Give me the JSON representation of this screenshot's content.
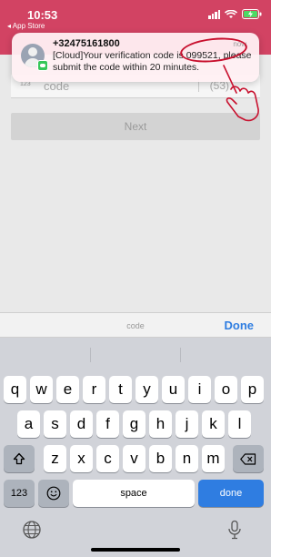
{
  "status_bar": {
    "time": "10:53",
    "back_app": "◂ App Store"
  },
  "notification": {
    "sender": "+32475161800",
    "when": "now",
    "message": "[Cloud]Your verification code is 099521, please submit the code within 20 minutes."
  },
  "form": {
    "code_icon": "123",
    "code_placeholder": "code",
    "timer": "(53)",
    "next_label": "Next"
  },
  "keyboard_toolbar": {
    "label": "code",
    "done_label": "Done"
  },
  "keyboard": {
    "row1": [
      "q",
      "w",
      "e",
      "r",
      "t",
      "y",
      "u",
      "i",
      "o",
      "p"
    ],
    "row2": [
      "a",
      "s",
      "d",
      "f",
      "g",
      "h",
      "j",
      "k",
      "l"
    ],
    "row3": [
      "z",
      "x",
      "c",
      "v",
      "b",
      "n",
      "m"
    ],
    "numbers_label": "123",
    "space_label": "space",
    "return_label": "done"
  },
  "colors": {
    "accent": "#2f7de1",
    "header": "#d24363",
    "annotation": "#c8102e"
  }
}
